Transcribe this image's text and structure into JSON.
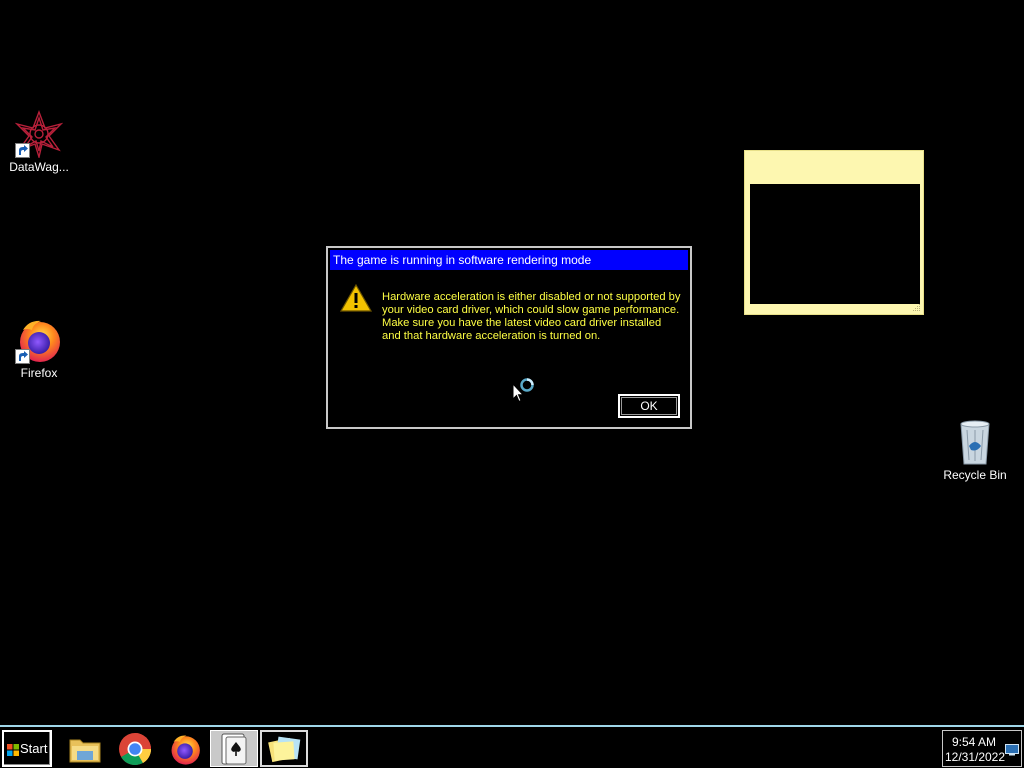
{
  "desktop": {
    "icons": [
      {
        "label": "DataWag..."
      },
      {
        "label": "Firefox"
      },
      {
        "label": "Recycle Bin"
      }
    ]
  },
  "dialog": {
    "title": "The game is running in software rendering mode",
    "message": "Hardware acceleration is either disabled or not supported by your video card driver, which could slow game performance. Make sure you have the latest video card driver installed and that hardware acceleration is turned on.",
    "ok_label": "OK",
    "icon": "warning-icon"
  },
  "taskbar": {
    "start_label": "Start",
    "items": [
      {
        "name": "file-explorer",
        "icon": "folder-icon"
      },
      {
        "name": "chrome",
        "icon": "chrome-icon"
      },
      {
        "name": "firefox",
        "icon": "firefox-icon"
      },
      {
        "name": "solitaire",
        "icon": "card-icon",
        "active": true
      },
      {
        "name": "sticky-notes",
        "icon": "sticky-notes-icon"
      }
    ],
    "clock": {
      "time": "9:54 AM",
      "date": "12/31/2022"
    }
  },
  "colors": {
    "dialog_title_bg": "#0000ff",
    "dialog_message": "#ffff44",
    "sticky_note": "#fdf7b0",
    "taskbar_border": "#9fd6e8"
  }
}
